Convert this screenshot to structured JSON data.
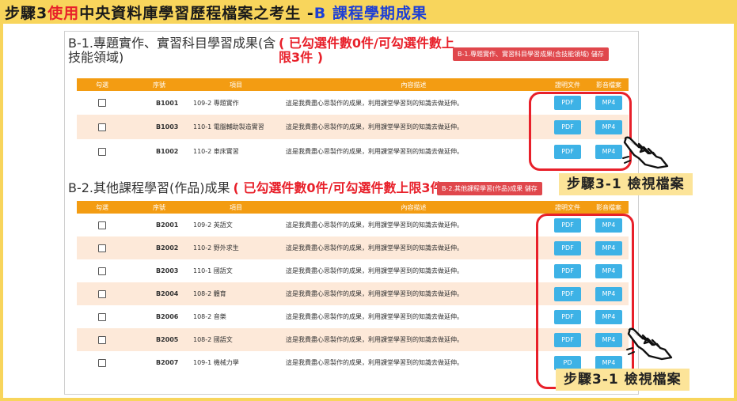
{
  "header": {
    "step_prefix": "步驟3 ",
    "use_word": "使用",
    "middle": "中央資料庫學習歷程檔案之考生 - ",
    "blue_part": "B 課程學期成果"
  },
  "section_b1": {
    "title_line1": "B-1.專題實作、實習科目學習成果(含",
    "title_line2": "技能領域)",
    "count_line1": "( 已勾選件數0件/可勾選件數上",
    "count_line2": "限3件 )",
    "save_label": "B-1.專題實作、實習科目學習成果(含技能領域) 儲存",
    "rows": [
      {
        "no": "B1001",
        "item": "109-2 專題實作",
        "desc": "這是我費盡心思製作的成果，利用課堂學習到的知識去做延伸。",
        "pdf": "PDF",
        "mp4": "MP4"
      },
      {
        "no": "B1003",
        "item": "110-1 電腦輔助製造實習",
        "desc": "這是我費盡心思製作的成果，利用課堂學習到的知識去做延伸。",
        "pdf": "PDF",
        "mp4": "MP4"
      },
      {
        "no": "B1002",
        "item": "110-2 車床實習",
        "desc": "這是我費盡心思製作的成果，利用課堂學習到的知識去做延伸。",
        "pdf": "PDF",
        "mp4": "MP4"
      }
    ]
  },
  "section_b2": {
    "title": "B-2.其他課程學習(作品)成果",
    "count": "( 已勾選件數0件/可勾選件數上限3件 )",
    "save_label": "B-2.其他課程學習(作品)成果 儲存",
    "rows": [
      {
        "no": "B2001",
        "item": "109-2 英語文",
        "desc": "這是我費盡心思製作的成果，利用課堂學習到的知識去做延伸。",
        "pdf": "PDF",
        "mp4": "MP4"
      },
      {
        "no": "B2002",
        "item": "110-2 野外求生",
        "desc": "這是我費盡心思製作的成果，利用課堂學習到的知識去做延伸。",
        "pdf": "PDF",
        "mp4": "MP4"
      },
      {
        "no": "B2003",
        "item": "110-1 國語文",
        "desc": "這是我費盡心思製作的成果，利用課堂學習到的知識去做延伸。",
        "pdf": "PDF",
        "mp4": "MP4"
      },
      {
        "no": "B2004",
        "item": "108-2 體育",
        "desc": "這是我費盡心思製作的成果，利用課堂學習到的知識去做延伸。",
        "pdf": "PDF",
        "mp4": "MP4"
      },
      {
        "no": "B2006",
        "item": "108-2 音樂",
        "desc": "這是我費盡心思製作的成果，利用課堂學習到的知識去做延伸。",
        "pdf": "PDF",
        "mp4": "MP4"
      },
      {
        "no": "B2005",
        "item": "108-2 國語文",
        "desc": "這是我費盡心思製作的成果，利用課堂學習到的知識去做延伸。",
        "pdf": "PDF",
        "mp4": "MP4"
      },
      {
        "no": "B2007",
        "item": "109-1 機械力學",
        "desc": "這是我費盡心思製作的成果，利用課堂學習到的知識去做延伸。",
        "pdf": "PD",
        "mp4": "MP4"
      }
    ]
  },
  "table_headers": {
    "check": "勾選",
    "no": "序號",
    "item": "項目",
    "desc": "內容描述",
    "proof": "證明文件",
    "video": "影音檔案"
  },
  "callouts": {
    "first": "步驟3-1 檢視檔案",
    "second": "步驟3-1 檢視檔案"
  },
  "colors": {
    "header_yellow": "#f8d55c",
    "table_header_orange": "#f39c12",
    "row_alt": "#fde9d9",
    "file_button_blue": "#3db2e6",
    "highlight_red": "#e8202a",
    "save_button_red": "#e0474c",
    "title_blue": "#1d3fd6"
  }
}
